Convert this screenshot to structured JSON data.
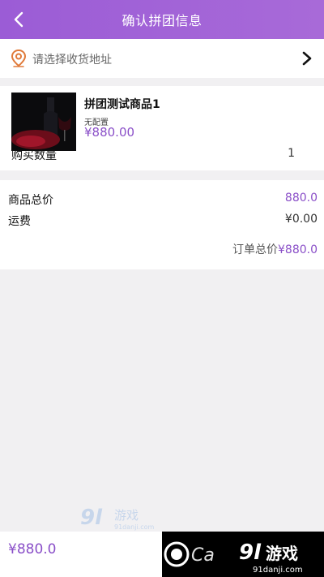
{
  "header": {
    "title": "确认拼团信息",
    "back_icon": "chevron-left-icon"
  },
  "address": {
    "placeholder": "请选择收货地址",
    "icon": "location-pin-icon",
    "action_icon": "chevron-right-icon"
  },
  "product": {
    "name": "拼团测试商品1",
    "spec": "无配置",
    "price": "¥880.00",
    "quantity_label": "购买数量",
    "quantity": "1"
  },
  "totals": {
    "goods_total_label": "商品总价",
    "goods_total_value": "880.0",
    "shipping_label": "运费",
    "shipping_value": "¥0.00",
    "order_total_label": "订单总价",
    "order_total_value": "¥880.0"
  },
  "footer": {
    "price": "¥880.0"
  },
  "watermark": {
    "brand": "9L游戏",
    "site": "91danji.com"
  },
  "colors": {
    "accent": "#8a4fc8",
    "header": "#a066d6",
    "background": "#f1f0f2"
  }
}
